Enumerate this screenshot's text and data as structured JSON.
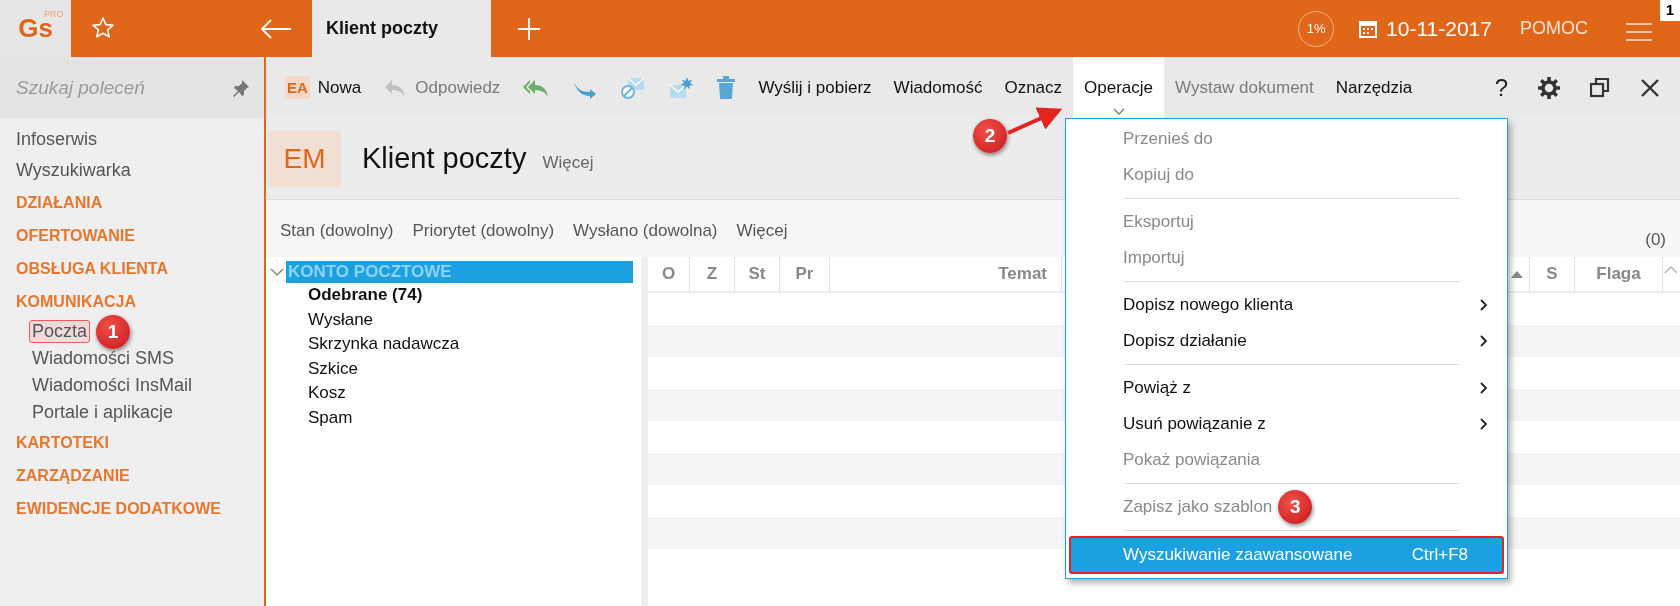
{
  "top_bar": {
    "logo": "Gs",
    "logo_tag": "PRO",
    "tab": {
      "label": "Klient poczty",
      "selected": true
    },
    "progress": "1%",
    "date": "10-11-2017",
    "help": "POMOC",
    "notifications": "1"
  },
  "sidebar": {
    "search": {
      "placeholder": "Szukaj poleceń"
    },
    "items": [
      {
        "kind": "link",
        "label": "Infoserwis"
      },
      {
        "kind": "link",
        "label": "Wyszukiwarka"
      },
      {
        "kind": "section",
        "label": "DZIAŁANIA"
      },
      {
        "kind": "section",
        "label": "OFERTOWANIE"
      },
      {
        "kind": "section",
        "label": "OBSŁUGA KLIENTA"
      },
      {
        "kind": "section",
        "label": "KOMUNIKACJA",
        "children": [
          {
            "label": "Poczta",
            "selected": true,
            "marked": true,
            "callout": "1"
          },
          {
            "label": "Wiadomości SMS",
            "selected": false,
            "marked": false
          },
          {
            "label": "Wiadomości InsMail",
            "selected": false,
            "marked": false
          },
          {
            "label": "Portale i aplikacje",
            "selected": false,
            "marked": false
          }
        ]
      },
      {
        "kind": "section",
        "label": "KARTOTEKI"
      },
      {
        "kind": "section",
        "label": "ZARZĄDZANIE"
      },
      {
        "kind": "section",
        "label": "EWIDENCJE DODATKOWE"
      }
    ]
  },
  "toolbar": {
    "items": [
      {
        "kind": "badge",
        "badge": "EA",
        "label": "Nowa",
        "disabled": false,
        "selected": false
      },
      {
        "kind": "reply",
        "label": "Odpowiedz",
        "disabled": true,
        "selected": false
      },
      {
        "kind": "reply-all",
        "disabled": false,
        "selected": false
      },
      {
        "kind": "forward",
        "disabled": false,
        "selected": false
      },
      {
        "kind": "mail-blocked",
        "disabled": false,
        "selected": false
      },
      {
        "kind": "mail-burst",
        "disabled": false,
        "selected": false
      },
      {
        "kind": "trash",
        "disabled": false,
        "selected": false
      },
      {
        "label": "Wyślij i pobierz",
        "disabled": false,
        "selected": false
      },
      {
        "label": "Wiadomość",
        "disabled": false,
        "selected": false
      },
      {
        "label": "Oznacz",
        "disabled": false,
        "selected": false
      },
      {
        "label": "Operacje",
        "disabled": false,
        "selected": true,
        "callout": "2"
      },
      {
        "label": "Wystaw dokument",
        "disabled": true,
        "selected": false
      },
      {
        "label": "Narzędzia",
        "disabled": false,
        "selected": false
      }
    ],
    "help": "?"
  },
  "header": {
    "badge": "EM",
    "title": "Klient poczty",
    "more": "Więcej"
  },
  "filters": {
    "items": [
      "Stan (dowolny)",
      "Priorytet (dowolny)",
      "Wysłano (dowolna)",
      "Więcej"
    ],
    "count": "(0)"
  },
  "tree": {
    "root": {
      "label": "KONTO POCZTOWE",
      "expanded": true,
      "selected": true,
      "children": [
        {
          "label": "Odebrane (74)",
          "unread": true,
          "selected": false
        },
        {
          "label": "Wysłane",
          "unread": false,
          "selected": false
        },
        {
          "label": "Skrzynka nadawcza",
          "unread": false,
          "selected": false
        },
        {
          "label": "Szkice",
          "unread": false,
          "selected": false
        },
        {
          "label": "Kosz",
          "unread": false,
          "selected": false
        },
        {
          "label": "Spam",
          "unread": false,
          "selected": false
        }
      ]
    }
  },
  "grid": {
    "columns": [
      {
        "label": "O",
        "sorted": false
      },
      {
        "label": "Z",
        "sorted": false
      },
      {
        "label": "St",
        "sorted": false
      },
      {
        "label": "Pr",
        "sorted": false
      },
      {
        "label": "Temat",
        "sorted": false
      },
      {
        "sorted": true
      },
      {
        "label": "S",
        "sorted": false
      },
      {
        "label": "Flaga",
        "sorted": false
      }
    ]
  },
  "menu": {
    "groups": [
      [
        {
          "label": "Przenieś do",
          "disabled": true,
          "submenu": false,
          "selected": false,
          "marked": false
        },
        {
          "label": "Kopiuj do",
          "disabled": true,
          "submenu": false,
          "selected": false,
          "marked": false
        }
      ],
      [
        {
          "label": "Eksportuj",
          "disabled": true,
          "submenu": false,
          "selected": false,
          "marked": false
        },
        {
          "label": "Importuj",
          "disabled": true,
          "submenu": false,
          "selected": false,
          "marked": false
        }
      ],
      [
        {
          "label": "Dopisz nowego klienta",
          "disabled": false,
          "submenu": true,
          "selected": false,
          "marked": false
        },
        {
          "label": "Dopisz działanie",
          "disabled": false,
          "submenu": true,
          "selected": false,
          "marked": false
        }
      ],
      [
        {
          "label": "Powiąż z",
          "disabled": false,
          "submenu": true,
          "selected": false,
          "marked": false
        },
        {
          "label": "Usuń powiązanie z",
          "disabled": false,
          "submenu": true,
          "selected": false,
          "marked": false
        },
        {
          "label": "Pokaż powiązania",
          "disabled": true,
          "submenu": false,
          "selected": false,
          "marked": false
        }
      ],
      [
        {
          "label": "Zapisz jako szablon",
          "disabled": true,
          "submenu": false,
          "selected": false,
          "marked": false,
          "callout": "3"
        }
      ],
      [
        {
          "label": "Wyszukiwanie zaawansowane",
          "shortcut": "Ctrl+F8",
          "disabled": false,
          "submenu": false,
          "selected": true,
          "marked": true
        }
      ]
    ]
  }
}
